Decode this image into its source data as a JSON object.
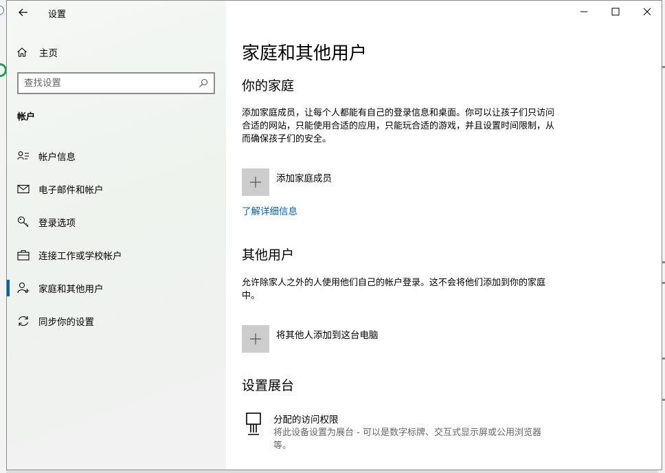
{
  "window": {
    "title": "设置",
    "controls": [
      "minimize",
      "maximize",
      "close"
    ]
  },
  "sidebar": {
    "home_label": "主页",
    "search_placeholder": "查找设置",
    "section_label": "帐户",
    "items": [
      {
        "label": "帐户信息",
        "icon": "account-info-icon",
        "active": false
      },
      {
        "label": "电子邮件和帐户",
        "icon": "mail-icon",
        "active": false
      },
      {
        "label": "登录选项",
        "icon": "key-icon",
        "active": false
      },
      {
        "label": "连接工作或学校帐户",
        "icon": "briefcase-icon",
        "active": false
      },
      {
        "label": "家庭和其他用户",
        "icon": "person-add-icon",
        "active": true
      },
      {
        "label": "同步你的设置",
        "icon": "sync-icon",
        "active": false
      }
    ]
  },
  "main": {
    "page_title": "家庭和其他用户",
    "family": {
      "heading": "你的家庭",
      "description": "添加家庭成员，让每个人都能有自己的登录信息和桌面。你可以让孩子们只访问合适的网站，只能使用合适的应用，只能玩合适的游戏，并且设置时间限制，从而确保孩子们的安全。",
      "add_label": "添加家庭成员",
      "learn_more": "了解详细信息"
    },
    "others": {
      "heading": "其他用户",
      "description": "允许除家人之外的人使用他们自己的帐户登录。这不会将他们添加到你的家庭中。",
      "add_label": "将其他人添加到这台电脑"
    },
    "kiosk": {
      "heading": "设置展台",
      "title": "分配的访问权限",
      "description": "将此设备设置为展台 - 可以是数字标牌、交互式显示屏或公用浏览器等。"
    }
  },
  "colors": {
    "accent": "#0063b1",
    "tile": "#cccccc",
    "secondary_text": "#666666"
  }
}
